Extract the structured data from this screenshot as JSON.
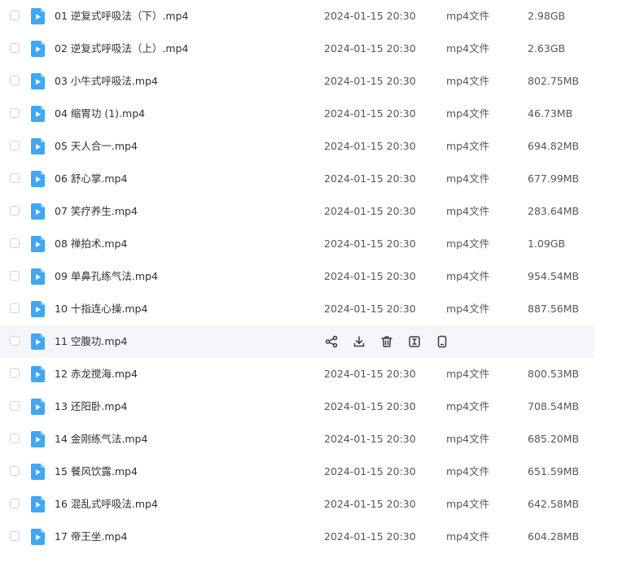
{
  "files": [
    {
      "name": "01 逆复式呼吸法（下）.mp4",
      "date": "2024-01-15 20:30",
      "type": "mp4文件",
      "size": "2.98GB"
    },
    {
      "name": "02 逆复式呼吸法（上）.mp4",
      "date": "2024-01-15 20:30",
      "type": "mp4文件",
      "size": "2.63GB"
    },
    {
      "name": "03 小牛式呼吸法.mp4",
      "date": "2024-01-15 20:30",
      "type": "mp4文件",
      "size": "802.75MB"
    },
    {
      "name": "04 缩胃功 (1).mp4",
      "date": "2024-01-15 20:30",
      "type": "mp4文件",
      "size": "46.73MB"
    },
    {
      "name": "05 天人合一.mp4",
      "date": "2024-01-15 20:30",
      "type": "mp4文件",
      "size": "694.82MB"
    },
    {
      "name": "06 舒心掌.mp4",
      "date": "2024-01-15 20:30",
      "type": "mp4文件",
      "size": "677.99MB"
    },
    {
      "name": "07 笑疗养生.mp4",
      "date": "2024-01-15 20:30",
      "type": "mp4文件",
      "size": "283.64MB"
    },
    {
      "name": "08 禅拍术.mp4",
      "date": "2024-01-15 20:30",
      "type": "mp4文件",
      "size": "1.09GB"
    },
    {
      "name": "09 单鼻孔练气法.mp4",
      "date": "2024-01-15 20:30",
      "type": "mp4文件",
      "size": "954.54MB"
    },
    {
      "name": "10 十指连心操.mp4",
      "date": "2024-01-15 20:30",
      "type": "mp4文件",
      "size": "887.56MB"
    },
    {
      "name": "11 空腹功.mp4",
      "hovered": true,
      "actions": [
        "share-icon",
        "download-icon",
        "delete-icon",
        "rename-icon",
        "mobile-icon"
      ]
    },
    {
      "name": "12 赤龙搅海.mp4",
      "date": "2024-01-15 20:30",
      "type": "mp4文件",
      "size": "800.53MB"
    },
    {
      "name": "13 还阳卧.mp4",
      "date": "2024-01-15 20:30",
      "type": "mp4文件",
      "size": "708.54MB"
    },
    {
      "name": "14 金刚练气法.mp4",
      "date": "2024-01-15 20:30",
      "type": "mp4文件",
      "size": "685.20MB"
    },
    {
      "name": "15 餐风饮露.mp4",
      "date": "2024-01-15 20:30",
      "type": "mp4文件",
      "size": "651.59MB"
    },
    {
      "name": "16 混乱式呼吸法.mp4",
      "date": "2024-01-15 20:30",
      "type": "mp4文件",
      "size": "642.58MB"
    },
    {
      "name": "17 帝王坐.mp4",
      "date": "2024-01-15 20:30",
      "type": "mp4文件",
      "size": "604.28MB"
    }
  ],
  "colors": {
    "video_icon": "#3fa7f5",
    "video_icon_fold": "#8fd0fb",
    "hover_row": "#f5f6fa",
    "action_icon": "#3c3d40"
  }
}
